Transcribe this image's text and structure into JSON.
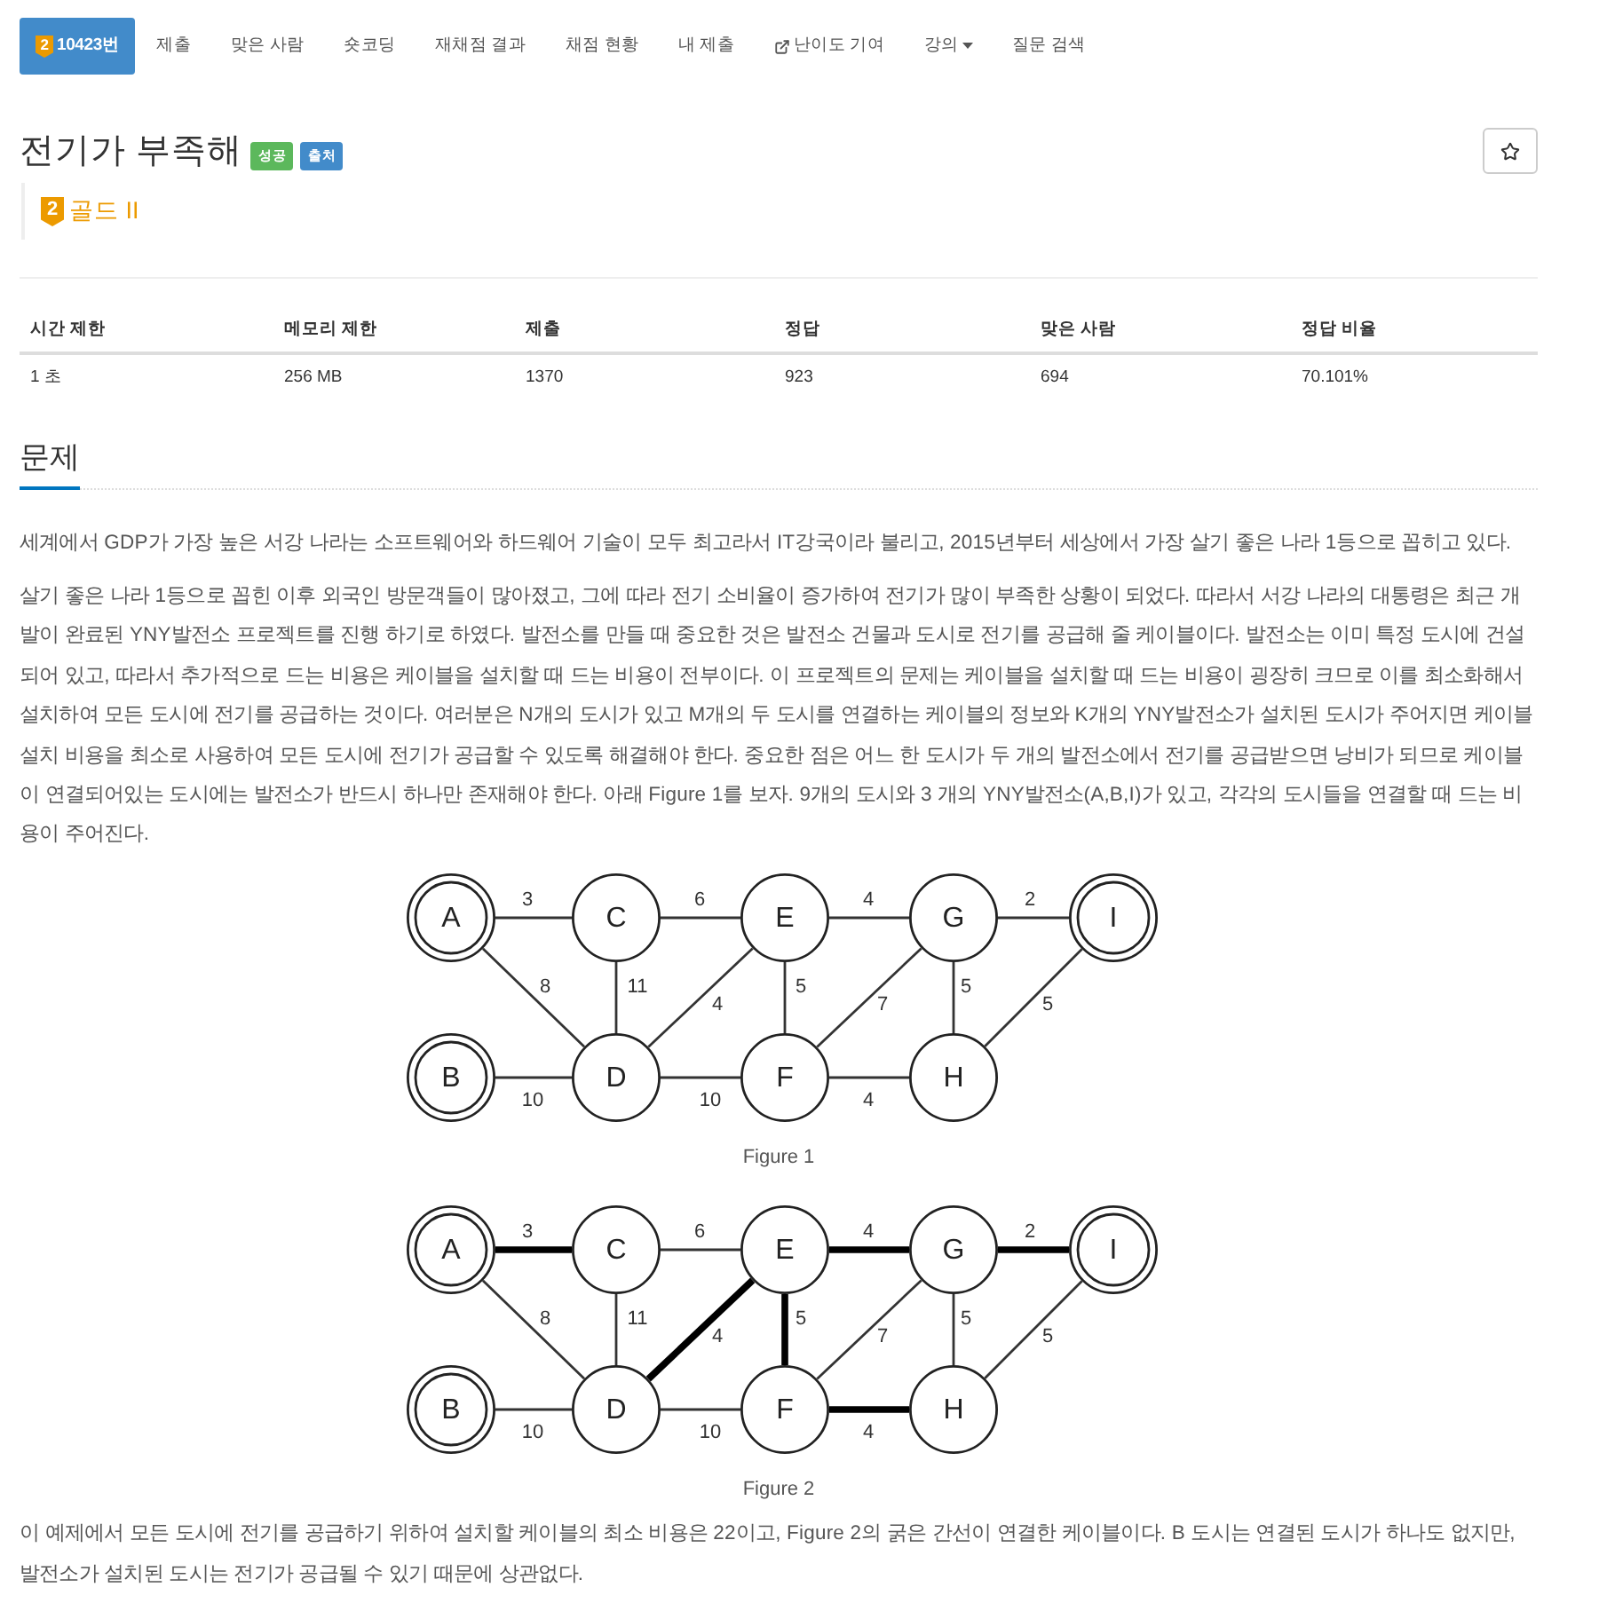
{
  "nav": {
    "items": [
      {
        "label": "10423번",
        "kind": "tier",
        "tier_mark": "2",
        "selected": true
      },
      {
        "label": "제출",
        "kind": "plain",
        "selected": false
      },
      {
        "label": "맞은 사람",
        "kind": "plain",
        "selected": false
      },
      {
        "label": "숏코딩",
        "kind": "plain",
        "selected": false
      },
      {
        "label": "재채점 결과",
        "kind": "plain",
        "selected": false
      },
      {
        "label": "채점 현황",
        "kind": "plain",
        "selected": false
      },
      {
        "label": "내 제출",
        "kind": "plain",
        "selected": false
      },
      {
        "label": "난이도 기여",
        "kind": "external",
        "selected": false
      },
      {
        "label": "강의",
        "kind": "dropdown",
        "selected": false
      },
      {
        "label": "질문 검색",
        "kind": "plain",
        "selected": false
      }
    ]
  },
  "problem": {
    "title": "전기가 부족해",
    "labels": [
      {
        "text": "성공",
        "color": "#5cb85c"
      },
      {
        "text": "출처",
        "color": "#428bca"
      }
    ],
    "tier": {
      "mark": "2",
      "name": "골드 II"
    }
  },
  "stats": {
    "columns": [
      "시간 제한",
      "메모리 제한",
      "제출",
      "정답",
      "맞은 사람",
      "정답 비율"
    ],
    "rows": [
      [
        "1 초",
        "256 MB",
        "1370",
        "923",
        "694",
        "70.101%"
      ]
    ]
  },
  "section": {
    "heading": "문제",
    "paragraphs": [
      "세계에서 GDP가 가장 높은 서강 나라는 소프트웨어와 하드웨어 기술이 모두 최고라서 IT강국이라 불리고, 2015년부터 세상에서 가장 살기 좋은 나라 1등으로 꼽히고 있다.",
      "살기 좋은 나라 1등으로 꼽힌 이후 외국인 방문객들이 많아졌고, 그에 따라 전기 소비율이 증가하여 전기가 많이 부족한 상황이 되었다. 따라서 서강 나라의 대통령은 최근 개발이 완료된 YNY발전소 프로젝트를 진행 하기로 하였다. 발전소를 만들 때 중요한 것은 발전소 건물과 도시로 전기를 공급해 줄 케이블이다. 발전소는 이미 특정 도시에 건설되어 있고, 따라서 추가적으로 드는 비용은 케이블을 설치할 때 드는 비용이 전부이다. 이 프로젝트의 문제는 케이블을 설치할 때 드는 비용이 굉장히 크므로 이를 최소화해서 설치하여 모든 도시에 전기를 공급하는 것이다. 여러분은 N개의 도시가 있고 M개의 두 도시를 연결하는 케이블의 정보와 K개의 YNY발전소가 설치된 도시가 주어지면 케이블 설치 비용을 최소로 사용하여 모든 도시에 전기가 공급할 수 있도록 해결해야 한다. 중요한 점은 어느 한 도시가 두 개의 발전소에서 전기를 공급받으면 낭비가 되므로 케이블이 연결되어있는 도시에는 발전소가 반드시 하나만 존재해야 한다. 아래 Figure 1를 보자. 9개의 도시와 3 개의 YNY발전소(A,B,I)가 있고, 각각의 도시들을 연결할 때 드는 비용이 주어진다."
    ],
    "figures": [
      {
        "caption": "Figure 1",
        "nodes": [
          {
            "label": "A",
            "kind": "plant"
          },
          {
            "label": "C",
            "kind": "city"
          },
          {
            "label": "E",
            "kind": "city"
          },
          {
            "label": "G",
            "kind": "city"
          },
          {
            "label": "I",
            "kind": "plant"
          },
          {
            "label": "B",
            "kind": "plant"
          },
          {
            "label": "D",
            "kind": "city"
          },
          {
            "label": "F",
            "kind": "city"
          },
          {
            "label": "H",
            "kind": "city"
          }
        ],
        "edges": [
          {
            "weight": "3",
            "bold": false
          },
          {
            "weight": "6",
            "bold": false
          },
          {
            "weight": "4",
            "bold": false
          },
          {
            "weight": "2",
            "bold": false
          },
          {
            "weight": "8",
            "bold": false
          },
          {
            "weight": "11",
            "bold": false
          },
          {
            "weight": "4",
            "bold": false
          },
          {
            "weight": "5",
            "bold": false
          },
          {
            "weight": "7",
            "bold": false
          },
          {
            "weight": "5",
            "bold": false
          },
          {
            "weight": "5",
            "bold": false
          },
          {
            "weight": "10",
            "bold": false
          },
          {
            "weight": "10",
            "bold": false
          },
          {
            "weight": "4",
            "bold": false
          }
        ]
      },
      {
        "caption": "Figure 2",
        "nodes": [
          {
            "label": "A",
            "kind": "plant"
          },
          {
            "label": "C",
            "kind": "city"
          },
          {
            "label": "E",
            "kind": "city"
          },
          {
            "label": "G",
            "kind": "city"
          },
          {
            "label": "I",
            "kind": "plant"
          },
          {
            "label": "B",
            "kind": "plant"
          },
          {
            "label": "D",
            "kind": "city"
          },
          {
            "label": "F",
            "kind": "city"
          },
          {
            "label": "H",
            "kind": "city"
          }
        ],
        "edges": [
          {
            "weight": "3",
            "bold": true
          },
          {
            "weight": "6",
            "bold": false
          },
          {
            "weight": "4",
            "bold": true
          },
          {
            "weight": "2",
            "bold": true
          },
          {
            "weight": "8",
            "bold": false
          },
          {
            "weight": "11",
            "bold": false
          },
          {
            "weight": "4",
            "bold": true
          },
          {
            "weight": "5",
            "bold": true
          },
          {
            "weight": "7",
            "bold": false
          },
          {
            "weight": "5",
            "bold": false
          },
          {
            "weight": "5",
            "bold": false
          },
          {
            "weight": "10",
            "bold": false
          },
          {
            "weight": "10",
            "bold": false
          },
          {
            "weight": "4",
            "bold": true
          }
        ]
      }
    ],
    "closing": "이 예제에서 모든 도시에 전기를 공급하기 위하여 설치할 케이블의 최소 비용은 22이고, Figure 2의 굵은 간선이 연결한 케이블이다. B 도시는 연결된 도시가 하나도 없지만, 발전소가 설치된 도시는 전기가 공급될 수 있기 때문에 상관없다."
  }
}
